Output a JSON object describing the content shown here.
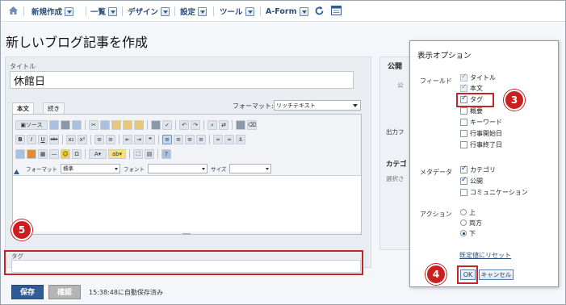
{
  "nav": {
    "items": [
      "新規作成",
      "一覧",
      "デザイン",
      "設定",
      "ツール",
      "A-Form"
    ]
  },
  "page": {
    "title": "新しいブログ記事を作成"
  },
  "entry": {
    "title_label": "タイトル",
    "title_value": "休館日",
    "tabs": [
      "本文",
      "続き"
    ],
    "format_label": "フォーマット:",
    "format_value": "リッチテキスト",
    "toolbar": {
      "source_label": "ソース",
      "bold": "B",
      "italic": "I",
      "underline": "U",
      "strike": "abc",
      "sub": "x₂",
      "sup": "x²",
      "format_label": "フォーマット",
      "format_value": "標準",
      "font_label": "フォント",
      "size_label": "サイズ"
    },
    "tag_label": "タグ"
  },
  "actions": {
    "save": "保存",
    "confirm": "確認",
    "autosave_status": "15:38:48に自動保存済み"
  },
  "sidebar": {
    "publish_heading": "公開",
    "publish_partial_1": "公",
    "output_partial": "出力フ",
    "category_heading": "カテゴ",
    "category_hint": "選択さ"
  },
  "options_popup": {
    "title": "表示オプション",
    "field_group_label": "フィールド",
    "fields": [
      {
        "label": "タイトル",
        "checked": true,
        "disabled": true
      },
      {
        "label": "本文",
        "checked": true,
        "disabled": true
      },
      {
        "label": "タグ",
        "checked": true,
        "disabled": false
      },
      {
        "label": "概要",
        "checked": false,
        "disabled": false
      },
      {
        "label": "キーワード",
        "checked": false,
        "disabled": false
      },
      {
        "label": "行事開始日",
        "checked": false,
        "disabled": false
      },
      {
        "label": "行事終了日",
        "checked": false,
        "disabled": false
      }
    ],
    "metadata_group_label": "メタデータ",
    "metadata": [
      {
        "label": "カテゴリ",
        "checked": true
      },
      {
        "label": "公開",
        "checked": true
      },
      {
        "label": "コミュニケーション",
        "checked": false
      }
    ],
    "action_group_label": "アクション",
    "action_positions": [
      {
        "label": "上",
        "checked": false
      },
      {
        "label": "両方",
        "checked": false
      },
      {
        "label": "下",
        "checked": true
      }
    ],
    "reset_label": "既定値にリセット",
    "ok_label": "OK",
    "cancel_label": "キャンセル"
  },
  "callouts": [
    "3",
    "4",
    "5"
  ],
  "colors": {
    "accent_blue": "#2f5b96",
    "highlight_red": "#c0262a",
    "callout_red": "#c9201f"
  }
}
